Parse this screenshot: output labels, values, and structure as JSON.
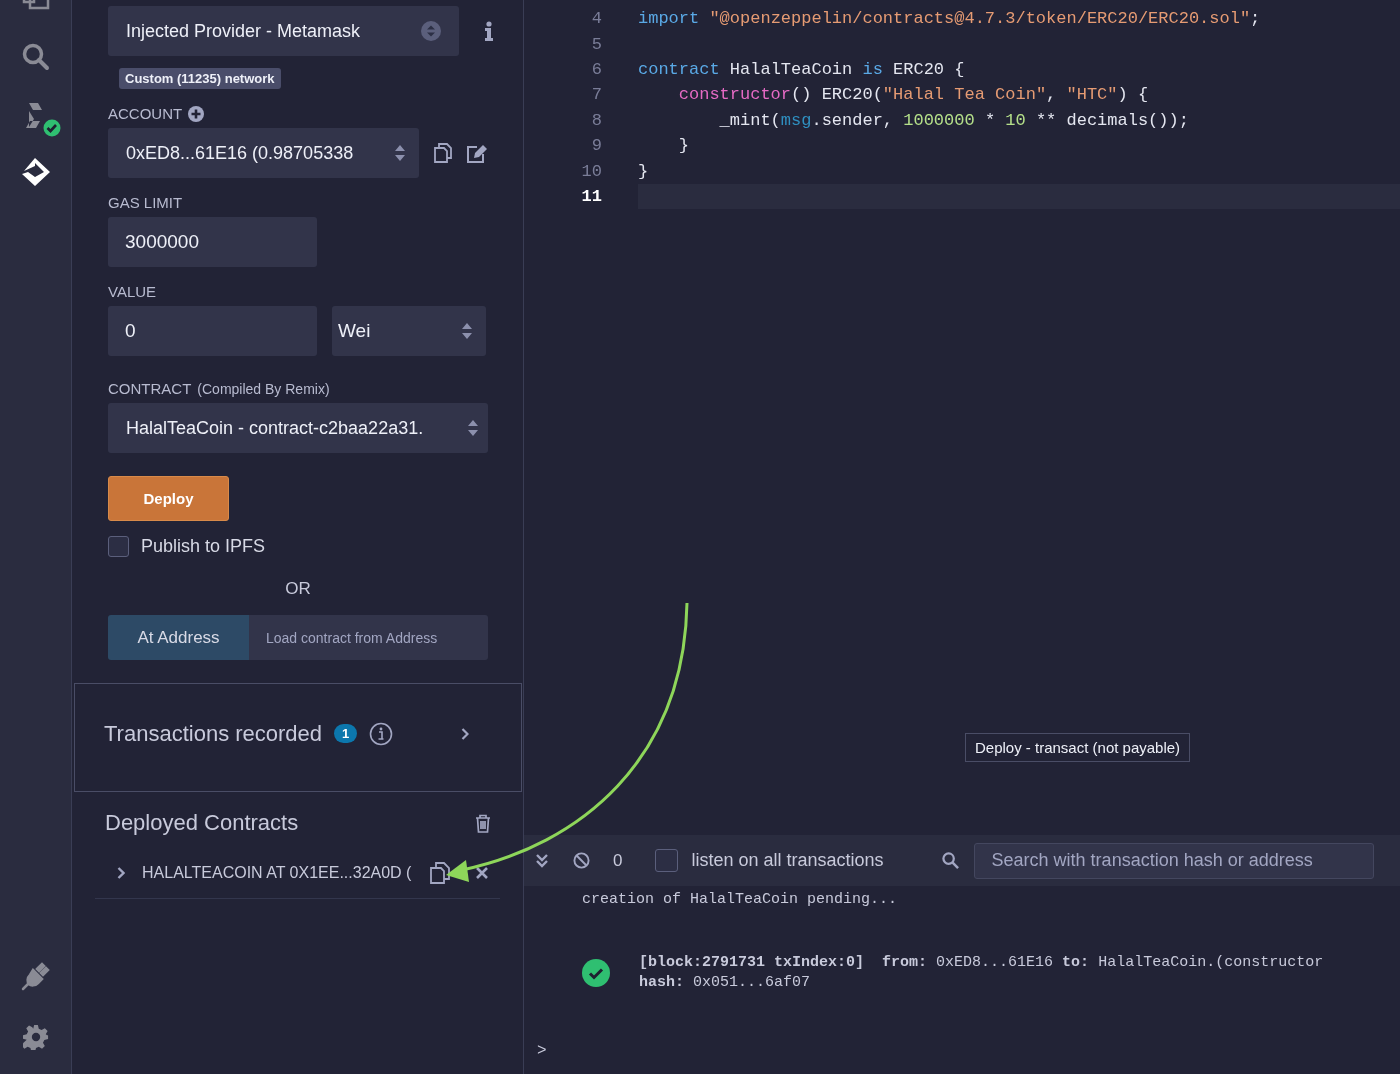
{
  "activity_bar": [
    {
      "selected": false
    },
    {
      "selected": false
    },
    {
      "selected": false
    },
    {
      "selected": true
    }
  ],
  "environment": {
    "value": "Injected Provider - Metamask",
    "network_badge": "Custom (11235) network"
  },
  "account": {
    "label": "ACCOUNT",
    "value": "0xED8...61E16 (0.98705338"
  },
  "gas_limit": {
    "label": "GAS LIMIT",
    "value": "3000000"
  },
  "value": {
    "label": "VALUE",
    "value": "0",
    "unit": "Wei"
  },
  "contract": {
    "label": "CONTRACT",
    "note": "(Compiled By Remix)",
    "value": "HalalTeaCoin - contract-c2baa22a31."
  },
  "deploy_button": "Deploy",
  "publish": {
    "label": "Publish to IPFS",
    "checked": false
  },
  "or_text": "OR",
  "at_address": {
    "button": "At Address",
    "placeholder": "Load contract from Address"
  },
  "transactions_recorded": {
    "title": "Transactions recorded",
    "count": "1"
  },
  "deployed_contracts": {
    "title": "Deployed Contracts",
    "items": [
      {
        "label": "HALALTEACOIN AT 0X1EE...32A0D (",
        "expanded": false
      }
    ]
  },
  "editor": {
    "lines": [
      {
        "number": "4",
        "current": false,
        "tokens": [
          {
            "kind": "keyword",
            "text": "import"
          },
          {
            "kind": "string",
            "text": " \"@openzeppelin/contracts@4.7.3/token/ERC20/ERC20.sol\""
          },
          {
            "kind": "plain",
            "text": ";"
          }
        ]
      },
      {
        "number": "5",
        "current": false
      },
      {
        "number": "6",
        "current": false,
        "tokens": [
          {
            "kind": "keyword",
            "text": "contract"
          },
          {
            "kind": "plain",
            "text": " HalalTeaCoin "
          },
          {
            "kind": "keyword",
            "text": "is"
          },
          {
            "kind": "plain",
            "text": " ERC20 {"
          }
        ]
      },
      {
        "number": "7",
        "current": false,
        "tokens": [
          {
            "kind": "function",
            "text": "    constructor"
          },
          {
            "kind": "plain",
            "text": "() ERC20("
          },
          {
            "kind": "string",
            "text": "\"Halal Tea Coin\""
          },
          {
            "kind": "plain",
            "text": ", "
          },
          {
            "kind": "string",
            "text": "\"HTC\""
          },
          {
            "kind": "plain",
            "text": ") {"
          }
        ]
      },
      {
        "number": "8",
        "current": false,
        "tokens": [
          {
            "kind": "plain",
            "text": "        _mint("
          },
          {
            "kind": "builtin",
            "text": "msg"
          },
          {
            "kind": "plain",
            "text": ".sender, "
          },
          {
            "kind": "number",
            "text": "1000000"
          },
          {
            "kind": "plain",
            "text": " * "
          },
          {
            "kind": "number",
            "text": "10"
          },
          {
            "kind": "plain",
            "text": " ** decimals());"
          }
        ]
      },
      {
        "number": "9",
        "current": false,
        "tokens": [
          {
            "kind": "plain",
            "text": "    }"
          }
        ]
      },
      {
        "number": "10",
        "current": false,
        "tokens": [
          {
            "kind": "plain",
            "text": "}"
          }
        ]
      },
      {
        "number": "11",
        "current": true
      }
    ]
  },
  "tooltip": "Deploy - transact (not payable)",
  "terminal": {
    "pending_count": "0",
    "listen": {
      "label": "listen on all transactions",
      "checked": false
    },
    "search_placeholder": "Search with transaction hash or address",
    "log": [
      {
        "kind": "text",
        "lines": [
          "creation of HalalTeaCoin pending..."
        ]
      },
      {
        "kind": "success",
        "lines": [
          "**[block:2791731 txIndex:0]**  **from:** 0xED8...61E16 **to:** HalalTeaCoin.(constructor",
          "**hash:** 0x051...6af07"
        ]
      }
    ],
    "prompt": ">"
  }
}
